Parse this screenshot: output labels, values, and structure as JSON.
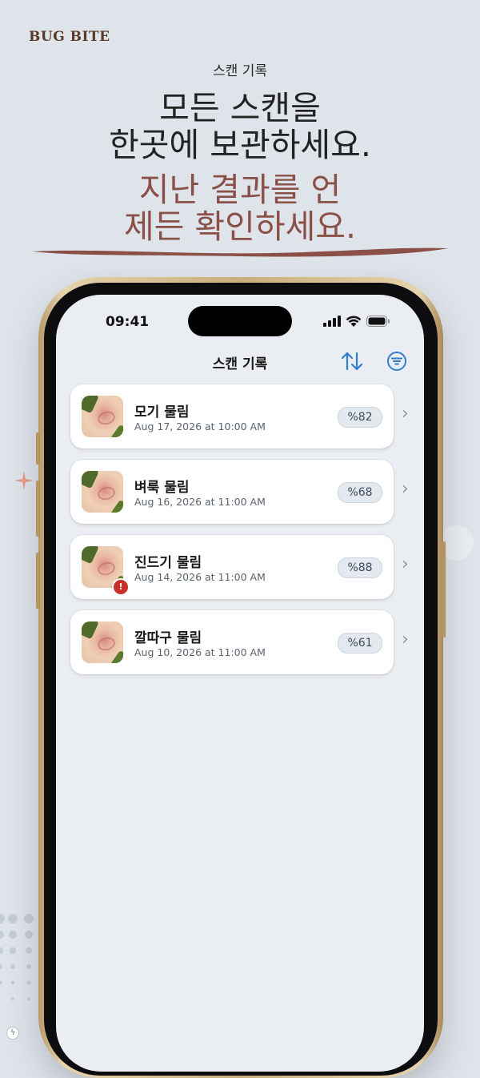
{
  "brand": "BUG BITE",
  "kicker": "스캔 기록",
  "headline": {
    "line1": "모든 스캔을",
    "line2": "한곳에 보관하세요.",
    "line3": "지난 결과를 언",
    "line4": "제든 확인하세요."
  },
  "colors": {
    "accent": "#8a5048",
    "brand": "#5a3a28",
    "ios_blue": "#2f7fd0",
    "warning": "#c8302a"
  },
  "status_bar": {
    "time": "09:41",
    "icons": [
      "signal-icon",
      "wifi-icon",
      "battery-icon"
    ]
  },
  "nav": {
    "title": "스캔 기록",
    "sort_icon": "sort-icon",
    "filter_icon": "filter-icon"
  },
  "scans": [
    {
      "title": "모기 물림",
      "date": "Aug 17, 2026 at 10:00 AM",
      "confidence": "%82",
      "warning": false
    },
    {
      "title": "벼룩 물림",
      "date": "Aug 16, 2026 at 11:00 AM",
      "confidence": "%68",
      "warning": false
    },
    {
      "title": "진드기 물림",
      "date": "Aug 14, 2026 at 11:00 AM",
      "confidence": "%88",
      "warning": true
    },
    {
      "title": "깔따구 물림",
      "date": "Aug 10, 2026 at 11:00 AM",
      "confidence": "%61",
      "warning": false
    }
  ],
  "warning_glyph": "!",
  "chevron_glyph": "›",
  "corner_glyph": "ϟ"
}
